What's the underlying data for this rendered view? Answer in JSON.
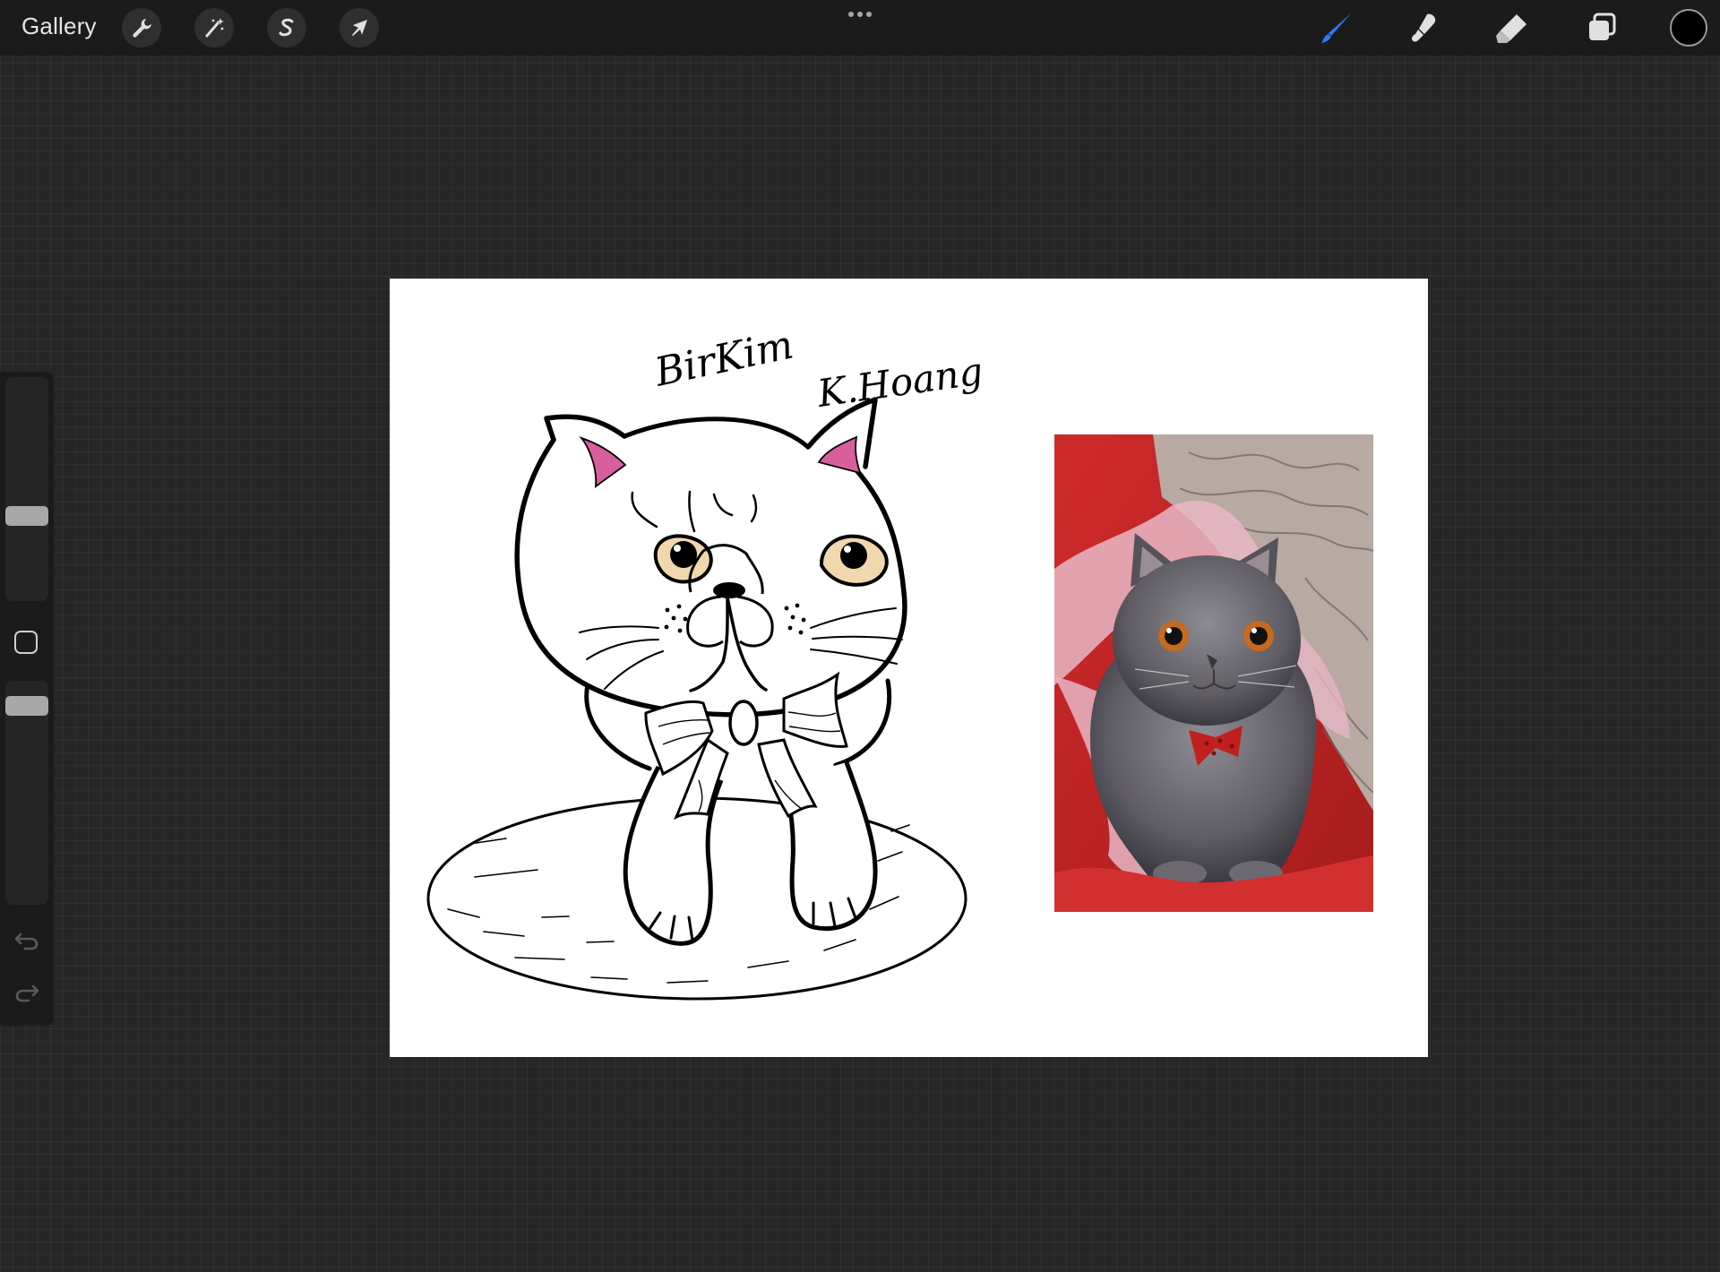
{
  "toolbar": {
    "gallery_label": "Gallery",
    "actions_icon": "wrench-icon",
    "adjustments_icon": "magic-wand-icon",
    "selection_icon": "selection-s-icon",
    "transform_icon": "arrow-cursor-icon",
    "more_icon": "ellipsis-icon",
    "brush_icon": "brush-icon",
    "smudge_icon": "smudge-icon",
    "eraser_icon": "eraser-icon",
    "layers_icon": "layers-icon",
    "brush_active_color": "#2d7bf6",
    "current_color": "#000000"
  },
  "sidebar": {
    "size_slider_icon": "slider-handle",
    "modify_icon": "square-icon",
    "opacity_slider_icon": "slider-handle",
    "undo_icon": "undo-icon",
    "redo_icon": "redo-icon"
  },
  "canvas": {
    "background": "#ffffff",
    "handwritten_text": [
      "BirKim",
      "K.Hoang"
    ],
    "left_content": "cat line drawing",
    "right_content": "reference photo of grey exotic shorthair cat"
  }
}
